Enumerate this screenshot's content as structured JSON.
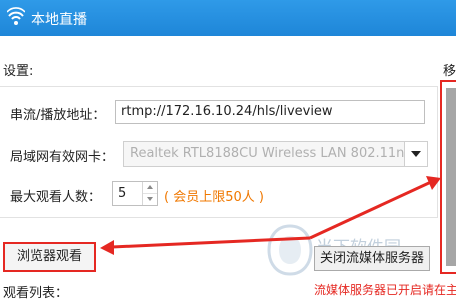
{
  "window": {
    "title": "本地直播"
  },
  "settings": {
    "section_label": "设置:",
    "url_label": "串流/播放地址：",
    "url_value": "rtmp://172.16.10.24/hls/liveview",
    "nic_label": "局域网有效网卡：",
    "nic_value": "Realtek RTL8188CU Wireless LAN 802.11n",
    "max_viewers_label": "最大观看人数：",
    "max_viewers_value": "5",
    "member_limit_note": "( 会员上限50人 )"
  },
  "buttons": {
    "browser_watch": "浏览器观看",
    "close_server": "关闭流媒体服务器"
  },
  "status": {
    "server_text": "流媒体服务器已开启请在主"
  },
  "viewer_list": {
    "label": "观看列表："
  },
  "right_panel": {
    "label": "移"
  },
  "watermark": {
    "text": "当下软件园"
  },
  "colors": {
    "titlebar": "#1e86d8",
    "highlight": "#e52822",
    "note": "#f07800"
  }
}
